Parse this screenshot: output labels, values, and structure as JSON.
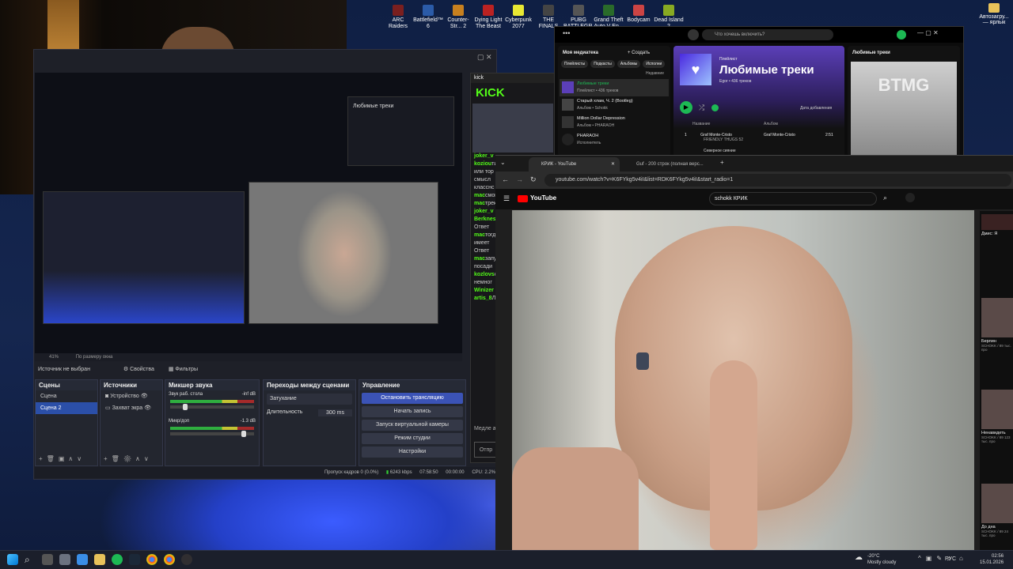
{
  "desktop": {
    "icons": [
      "ARC Raiders",
      "Battlefield™ 6",
      "Counter-Str... 2",
      "Dying Light The Beast",
      "Cyberpunk 2077",
      "THE FINALS",
      "PUBG BATTLEGR...",
      "Grand Theft Auto V En...",
      "Bodycam",
      "Dead Island 2"
    ],
    "right_icon": "Автозагру... — ярлык"
  },
  "obs": {
    "zoom": "41%",
    "zoom_mode": "По размеру окна",
    "source_status": "Источник не выбран",
    "props_button": "Свойства",
    "filters_button": "Фильтры",
    "scenes_title": "Сцены",
    "scenes": [
      "Сцена",
      "Сцена 2"
    ],
    "sources_title": "Источники",
    "sources": [
      "Устройство",
      "Захват экра"
    ],
    "mixer_title": "Микшер звука",
    "mixer": [
      {
        "name": "Звук раб. стола",
        "db": "-inf dB"
      },
      {
        "name": "Микр/доп",
        "db": "-1.3 dB"
      }
    ],
    "transitions_title": "Переходы между сценами",
    "transition": "Затухание",
    "duration_label": "Длительность",
    "duration": "300 ms",
    "controls_title": "Управление",
    "controls": [
      "Остановить трансляцию",
      "Начать запись",
      "Запуск виртуальной камеры",
      "Режим студии",
      "Настройки"
    ],
    "status": {
      "dropped": "Пропуск кадров 0 (0.0%)",
      "bitrate": "6243 kbps",
      "stream_time": "07:58:50",
      "rec_time": "00:00:00",
      "cpu": "CPU: 2.2%"
    }
  },
  "chat": {
    "title": "kick",
    "logo": "KICK",
    "lines": [
      {
        "user": "joker_v",
        "text": ""
      },
      {
        "user": "koziou",
        "text": "типо прик"
      },
      {
        "user": "",
        "text": "или тор"
      },
      {
        "user": "",
        "text": "смысл"
      },
      {
        "user": "",
        "text": "класснс"
      },
      {
        "user": "mac",
        "text": "смоке г"
      },
      {
        "user": "mac",
        "text": "трек"
      },
      {
        "user": "joker_v",
        "text": ""
      },
      {
        "user": "Berknes",
        "text": "слушан"
      },
      {
        "user": "",
        "text": "Ответ"
      },
      {
        "user": "mac",
        "text": "тогда б"
      },
      {
        "user": "",
        "text": "имеет"
      },
      {
        "user": "",
        "text": "Ответ"
      },
      {
        "user": "mac",
        "text": "запусти"
      },
      {
        "user": "",
        "text": "посади"
      },
      {
        "user": "kozlovs",
        "text": "сам фи"
      },
      {
        "user": "",
        "text": "немног"
      },
      {
        "user": "Winizer",
        "text": ""
      },
      {
        "user": "artis_8",
        "text": "ЛУКИН"
      }
    ],
    "footer": "Медле активн",
    "send": "Отпр"
  },
  "spotify": {
    "search_placeholder": "Что хочешь включить?",
    "library_title": "Моя медиатека",
    "create": "Создать",
    "filters": [
      "Плейлисты",
      "Подкасты",
      "Альбомы",
      "Исполни"
    ],
    "sort": "Недавние",
    "items": [
      {
        "title": "Любимые треки",
        "sub": "Плейлист • 436 треков"
      },
      {
        "title": "Старый хлам, Ч. 2 (Bootleg)",
        "sub": "Альбом • Schokk"
      },
      {
        "title": "Million Dollar Depression",
        "sub": "Альбом • PHARAOH"
      },
      {
        "title": "PHARAOH",
        "sub": "Исполнитель"
      }
    ],
    "playlist_kind": "Плейлист",
    "playlist_title": "Любимые треки",
    "playlist_meta": "Egor • 436 треков",
    "date_added": "Дата добавления",
    "col_title": "Название",
    "col_album": "Альбом",
    "track": {
      "num": "1",
      "title": "Graf Monte-Cristo",
      "artist": "FRIENDLY THUGS 52",
      "album": "Graf Monte-Cristo",
      "time": "2:51"
    },
    "track2": "Северное сияние",
    "right_title": "Любимые треки",
    "art_text": "BTMG"
  },
  "chrome": {
    "tabs": [
      "КРИК - YouTube",
      "Guf - 200 строк (полная верс..."
    ],
    "url": "youtube.com/watch?v=K6FYkg5v4iI&list=RDK6FYkg5v4iI&start_radio=1",
    "search": "schokk КРИК",
    "logo": "YouTube",
    "side": [
      {
        "title": "Дмис: Я",
        "sub": ""
      },
      {
        "title": "Берлин",
        "sub": "SCHOKK / 89 тыс. про"
      },
      {
        "title": "Ненавидеть",
        "sub": "SCHOKK / 89 123 тыс. про"
      },
      {
        "title": "До дна",
        "sub": "SCHOKK / 89 24 тыс. про"
      }
    ]
  },
  "taskbar": {
    "weather_temp": "-20°C",
    "weather_desc": "Mostly cloudy",
    "lang": "РУС",
    "time": "02:56",
    "date": "15.01.2026"
  }
}
